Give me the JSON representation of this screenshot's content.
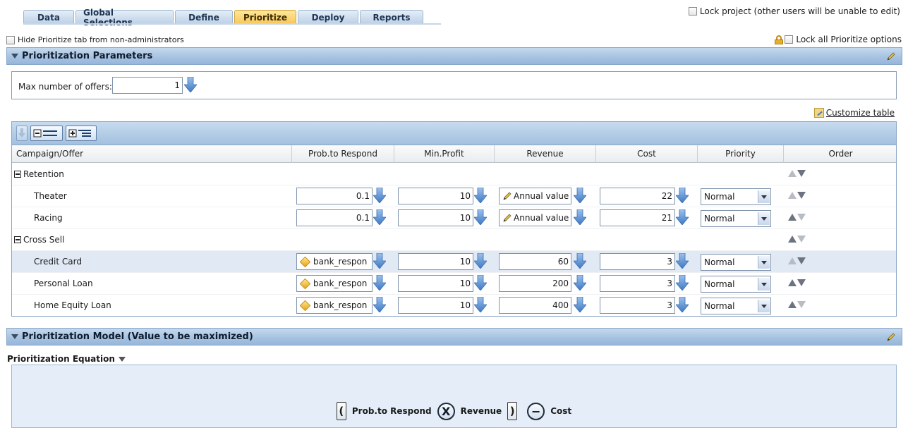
{
  "tabs": [
    {
      "label": "Data",
      "active": false
    },
    {
      "label": "Global Selections",
      "active": false
    },
    {
      "label": "Define",
      "active": false
    },
    {
      "label": "Prioritize",
      "active": true
    },
    {
      "label": "Deploy",
      "active": false
    },
    {
      "label": "Reports",
      "active": false
    }
  ],
  "lock_project_label": "Lock project (other users will be unable to edit)",
  "hide_tab_label": "Hide Prioritize tab from non-administrators",
  "lock_all_label": "Lock all Prioritize options",
  "params_section": {
    "title": "Prioritization Parameters",
    "max_offers_label": "Max number of offers:",
    "max_offers_value": "1"
  },
  "customize_table_label": "Customize table",
  "grid": {
    "columns": [
      "Campaign/Offer",
      "Prob.to Respond",
      "Min.Profit",
      "Revenue",
      "Cost",
      "Priority",
      "Order"
    ],
    "groups": [
      {
        "name": "Retention",
        "offers": [
          {
            "name": "Theater",
            "prob": "0.1",
            "min_profit": "10",
            "revenue": "Annual value",
            "cost": "22",
            "priority": "Normal"
          },
          {
            "name": "Racing",
            "prob": "0.1",
            "min_profit": "10",
            "revenue": "Annual value",
            "cost": "21",
            "priority": "Normal"
          }
        ]
      },
      {
        "name": "Cross Sell",
        "offers": [
          {
            "name": "Credit Card",
            "prob": "bank_respon",
            "min_profit": "10",
            "revenue": "60",
            "cost": "3",
            "priority": "Normal"
          },
          {
            "name": "Personal Loan",
            "prob": "bank_respon",
            "min_profit": "10",
            "revenue": "200",
            "cost": "3",
            "priority": "Normal"
          },
          {
            "name": "Home Equity Loan",
            "prob": "bank_respon",
            "min_profit": "10",
            "revenue": "400",
            "cost": "3",
            "priority": "Normal"
          }
        ]
      }
    ]
  },
  "model_section": {
    "title": "Prioritization Model (Value to be maximized)",
    "equation_label": "Prioritization Equation",
    "terms": {
      "open": "(",
      "prob": "Prob.to Respond",
      "times": "X",
      "revenue": "Revenue",
      "close": ")",
      "minus": "−",
      "cost": "Cost"
    }
  },
  "colors": {
    "active_tab": "#f7c75a",
    "header_blue": "#a7c3e1",
    "selected_row": "#e1e9f5",
    "arrow_blue": "#5b8fd0"
  }
}
